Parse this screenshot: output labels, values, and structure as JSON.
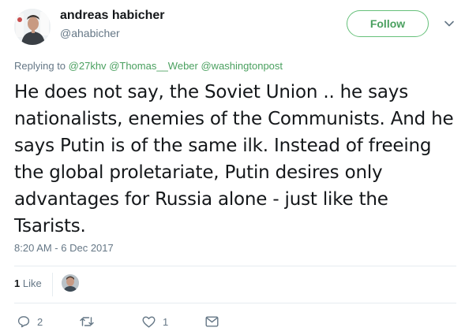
{
  "author": {
    "name": "andreas habicher",
    "handle": "@ahabicher",
    "avatar_icon": "user-avatar-photo"
  },
  "header": {
    "follow_label": "Follow",
    "menu_icon": "chevron-down-icon"
  },
  "reply": {
    "prefix": "Replying to",
    "mentions": [
      "@27khv",
      "@Thomas__Weber",
      "@washingtonpost"
    ]
  },
  "tweet": {
    "text": "He does not say, the Soviet Union .. he says nationalists, enemies of the Communists. And he says Putin is of the same ilk. Instead of freeing the global proletariate, Putin desires only advantages for Russia alone - just like the Tsarists.",
    "timestamp": "8:20 AM - 6 Dec 2017"
  },
  "stats": {
    "like_count": "1",
    "like_label": "Like"
  },
  "actions": {
    "reply_count": "2",
    "retweet_count": "",
    "like_count": "1"
  },
  "colors": {
    "accent": "#4aa05f",
    "muted": "#657786",
    "text": "#14171a",
    "divider": "#e6ecf0"
  }
}
